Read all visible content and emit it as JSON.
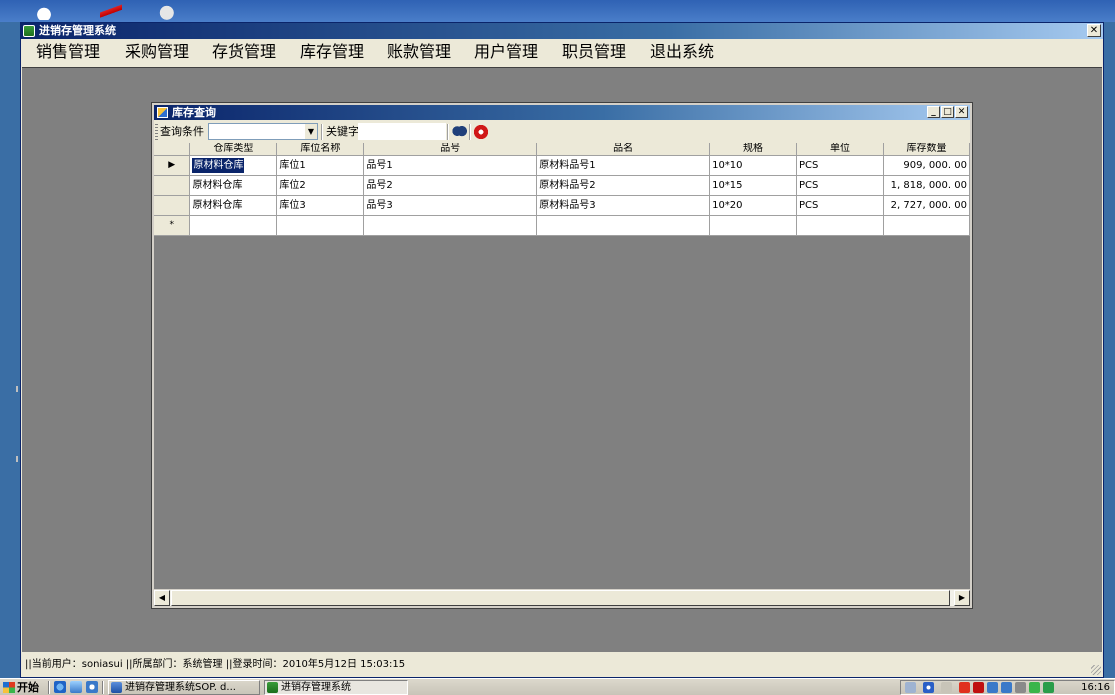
{
  "app": {
    "title": "进销存管理系统",
    "menu": [
      "销售管理",
      "采购管理",
      "存货管理",
      "库存管理",
      "账款管理",
      "用户管理",
      "职员管理",
      "退出系统"
    ]
  },
  "child_window": {
    "title": "库存查询",
    "toolbar": {
      "condition_label": "查询条件",
      "condition_value": "",
      "keyword_label": "关键字",
      "keyword_value": ""
    },
    "grid": {
      "columns": [
        "仓库类型",
        "库位名称",
        "品号",
        "品名",
        "规格",
        "单位",
        "库存数量"
      ],
      "rows": [
        [
          "原材料仓库",
          "库位1",
          "品号1",
          "原材料品号1",
          "10*10",
          "PCS",
          "909, 000. 00"
        ],
        [
          "原材料仓库",
          "库位2",
          "品号2",
          "原材料品号2",
          "10*15",
          "PCS",
          "1, 818, 000. 00"
        ],
        [
          "原材料仓库",
          "库位3",
          "品号3",
          "原材料品号3",
          "10*20",
          "PCS",
          "2, 727, 000. 00"
        ]
      ],
      "current_row_marker": "▶",
      "new_row_marker": "*"
    }
  },
  "statusbar": {
    "text": "||当前用户：soniasui ||所属部门：系统管理 ||登录时间：2010年5月12日 15:03:15"
  },
  "taskbar": {
    "start_label": "开始",
    "tasks": [
      {
        "label": "进销存管理系统SOP. d...",
        "active": false
      },
      {
        "label": "进销存管理系统",
        "active": true
      }
    ],
    "clock": "16:16"
  },
  "colors": {
    "title_active": "#0a246a",
    "mdi_background": "#808080",
    "selection": "#0a246a"
  }
}
